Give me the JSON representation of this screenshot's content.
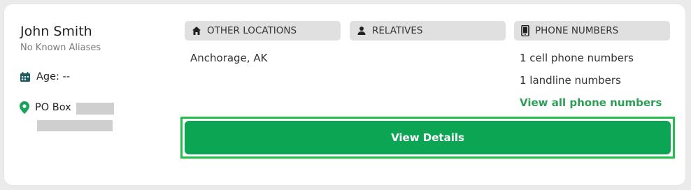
{
  "person": {
    "name": "John Smith",
    "aliases": "No Known Aliases",
    "age_label": "Age: --",
    "address_prefix": "PO Box"
  },
  "sections": {
    "locations": {
      "title": "OTHER LOCATIONS",
      "items": [
        "Anchorage, AK"
      ]
    },
    "relatives": {
      "title": "RELATIVES"
    },
    "phones": {
      "title": "PHONE NUMBERS",
      "cell": "1 cell phone numbers",
      "landline": "1 landline numbers",
      "link": "View all phone numbers"
    }
  },
  "actions": {
    "view_details": "View Details"
  },
  "colors": {
    "accent_green": "#0ba554",
    "link_green": "#2e9e57",
    "icon_teal": "#1c5c63",
    "pin_green": "#1aa25a"
  },
  "icons": {
    "age": "calendar-icon",
    "address": "map-pin-icon",
    "locations": "home-icon",
    "relatives": "person-icon",
    "phones": "mobile-phone-icon"
  }
}
